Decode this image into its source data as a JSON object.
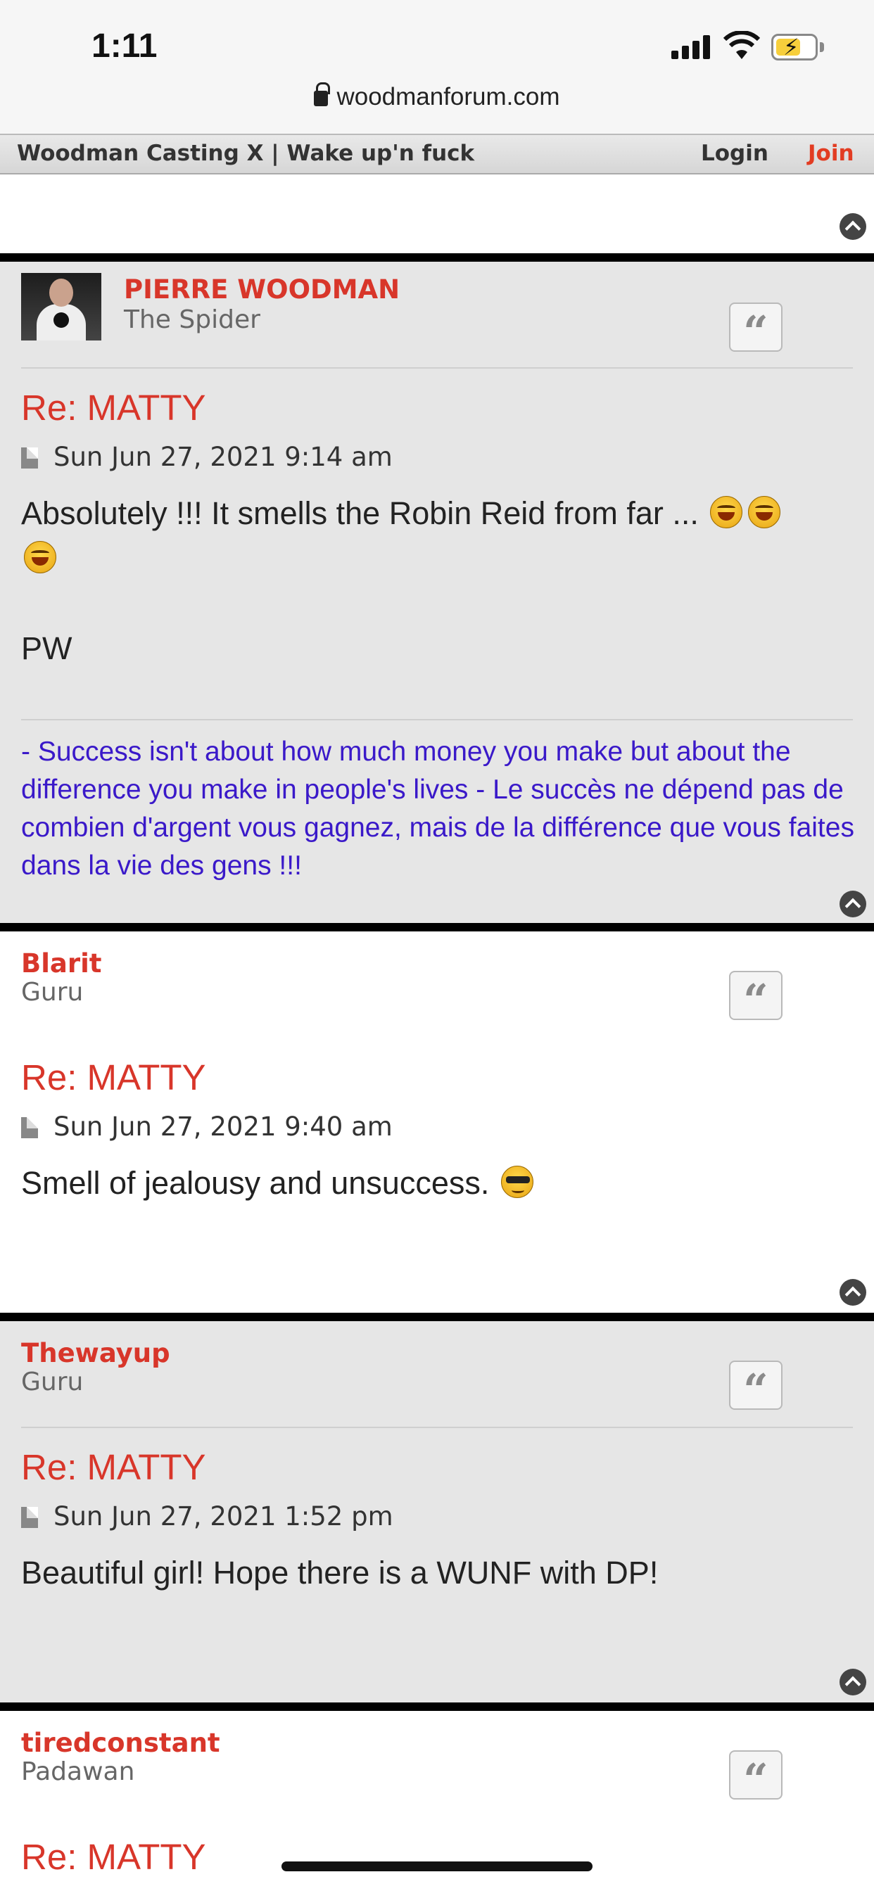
{
  "status_bar": {
    "time": "1:11"
  },
  "browser": {
    "url": "woodmanforum.com"
  },
  "site_nav": {
    "brand": "Woodman Casting X | Wake up'n fuck",
    "login": "Login",
    "join": "Join"
  },
  "posts": [
    {
      "author": "PIERRE WOODMAN",
      "rank": "The Spider",
      "title": "Re: MATTY",
      "date": "Sun Jun 27, 2021 9:14 am",
      "body_line1": "Absolutely !!! It smells the Robin Reid from far ...",
      "body_line2": "PW",
      "emoji": [
        "laughing-emoji",
        "laughing-emoji",
        "laughing-emoji"
      ],
      "signature": "- Success isn't about how much money you make but about the difference you make in people's lives - Le succès ne dépend pas de combien d'argent vous gagnez, mais de la différence que vous faites dans la vie des gens !!!"
    },
    {
      "author": "Blarit",
      "rank": "Guru",
      "title": "Re: MATTY",
      "date": "Sun Jun 27, 2021 9:40 am",
      "body": "Smell of jealousy and unsuccess.",
      "emoji": [
        "cool-emoji"
      ]
    },
    {
      "author": "Thewayup",
      "rank": "Guru",
      "title": "Re: MATTY",
      "date": "Sun Jun 27, 2021 1:52 pm",
      "body": "Beautiful girl! Hope there is a WUNF with DP!"
    },
    {
      "author": "tiredconstant",
      "rank": "Padawan",
      "title": "Re: MATTY"
    }
  ],
  "colors": {
    "accent_red": "#d8362a",
    "signature_blue": "#3a19c9",
    "post_grey": "#e6e6e6"
  },
  "icons": [
    "lock-icon",
    "signal-icon",
    "wifi-icon",
    "battery-icon",
    "back-to-top-icon",
    "quote-icon",
    "post-icon"
  ]
}
